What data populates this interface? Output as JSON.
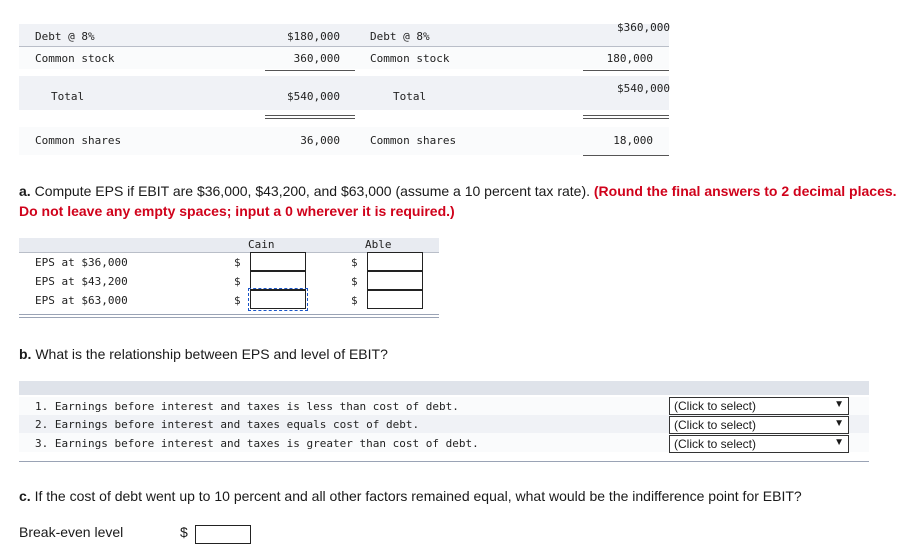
{
  "top_table": {
    "left": {
      "debt_label": "Debt @ 8%",
      "stock_label": "Common stock",
      "debt_value": "$180,000",
      "stock_value": "360,000",
      "total_label": "Total",
      "total_value": "$540,000",
      "shares_label": "Common shares",
      "shares_value": "36,000"
    },
    "right": {
      "debt_label": "Debt @ 8%",
      "stock_label": "Common stock",
      "debt_value": "$360,000",
      "stock_value": "180,000",
      "total_label": "Total",
      "total_value": "$540,000",
      "shares_label": "Common shares",
      "shares_value": "18,000"
    }
  },
  "part_a": {
    "prefix": "a.",
    "text": " Compute EPS if EBIT are $36,000, $43,200, and $63,000 (assume a 10 percent tax rate). ",
    "red_text": "(Round the final answers to 2 decimal places. Do not leave any empty spaces; input a 0 wherever it is required.)",
    "col_cain": "Cain",
    "col_able": "Able",
    "rows": [
      {
        "label": "EPS at $36,000",
        "cur": "$"
      },
      {
        "label": "EPS at $43,200",
        "cur": "$"
      },
      {
        "label": "EPS at $63,000",
        "cur": "$"
      }
    ]
  },
  "part_b": {
    "prefix": "b.",
    "text": " What is the relationship between EPS and level of EBIT?",
    "items": [
      {
        "text": "1. Earnings before interest and taxes is less than cost of debt.",
        "select": "(Click to select)"
      },
      {
        "text": "2. Earnings before interest and taxes equals cost of debt.",
        "select": "(Click to select)"
      },
      {
        "text": "3. Earnings before interest and taxes is greater than cost of debt.",
        "select": "(Click to select)"
      }
    ]
  },
  "part_c": {
    "prefix": "c.",
    "text": " If the cost of debt went up to 10 percent and all other factors remained equal, what would be the indifference point for EBIT?",
    "label": "Break-even level",
    "cur": "$"
  }
}
